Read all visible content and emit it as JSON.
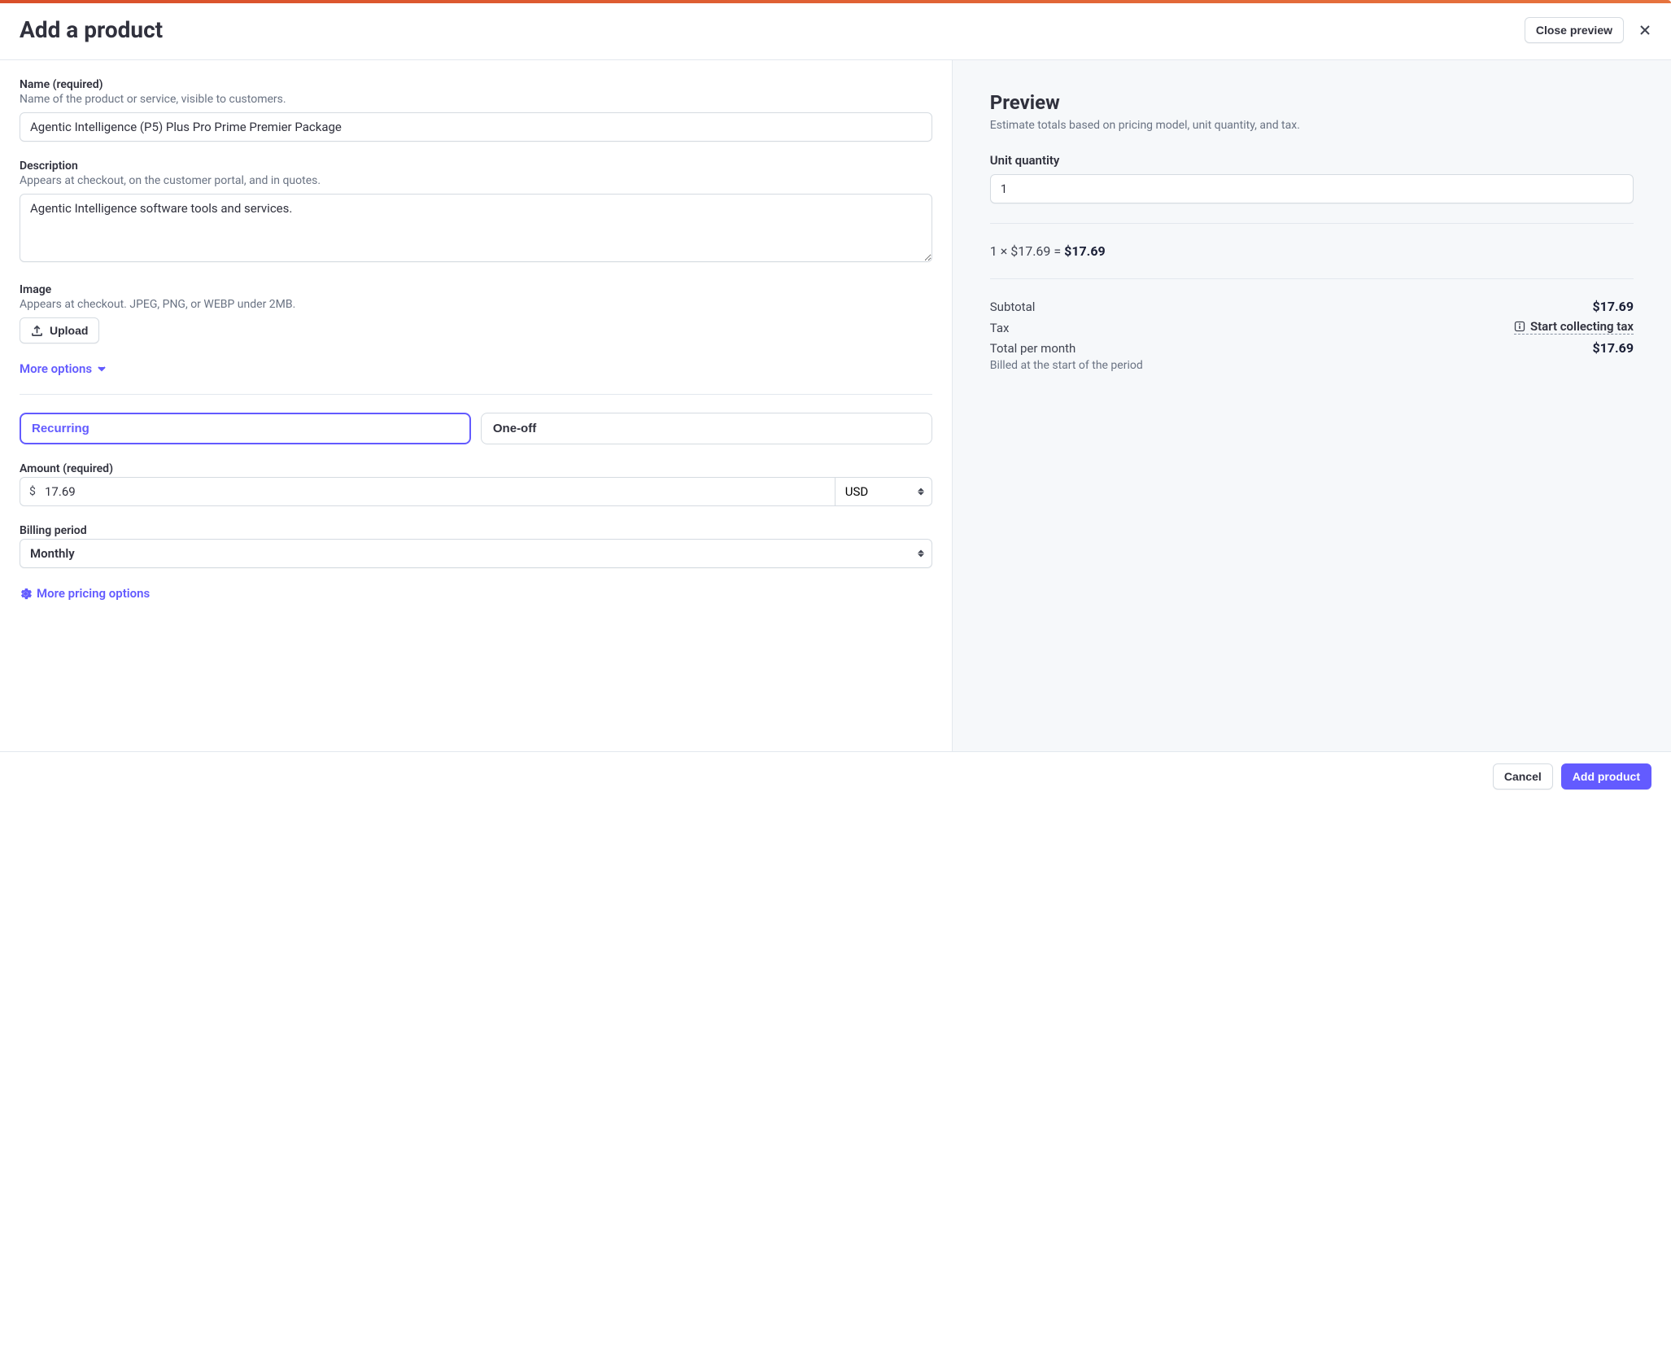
{
  "header": {
    "title": "Add a product",
    "close_preview": "Close preview"
  },
  "form": {
    "name": {
      "label": "Name (required)",
      "help": "Name of the product or service, visible to customers.",
      "value": "Agentic Intelligence (P5) Plus Pro Prime Premier Package"
    },
    "description": {
      "label": "Description",
      "help": "Appears at checkout, on the customer portal, and in quotes.",
      "value": "Agentic Intelligence software tools and services."
    },
    "image": {
      "label": "Image",
      "help": "Appears at checkout. JPEG, PNG, or WEBP under 2MB.",
      "upload_label": "Upload"
    },
    "more_options": "More options",
    "pricing_type": {
      "recurring": "Recurring",
      "one_off": "One-off"
    },
    "amount": {
      "label": "Amount (required)",
      "currency_symbol": "$",
      "value": "17.69",
      "currency": "USD"
    },
    "billing_period": {
      "label": "Billing period",
      "value": "Monthly"
    },
    "more_pricing": "More pricing options"
  },
  "preview": {
    "title": "Preview",
    "subtitle": "Estimate totals based on pricing model, unit quantity, and tax.",
    "unit_qty_label": "Unit quantity",
    "unit_qty_value": "1",
    "calc_left": "1 × $17.69 = ",
    "calc_total": "$17.69",
    "subtotal_label": "Subtotal",
    "subtotal_value": "$17.69",
    "tax_label": "Tax",
    "tax_action": "Start collecting tax",
    "total_label": "Total per month",
    "total_value": "$17.69",
    "billed_note": "Billed at the start of the period"
  },
  "footer": {
    "cancel": "Cancel",
    "submit": "Add product"
  }
}
